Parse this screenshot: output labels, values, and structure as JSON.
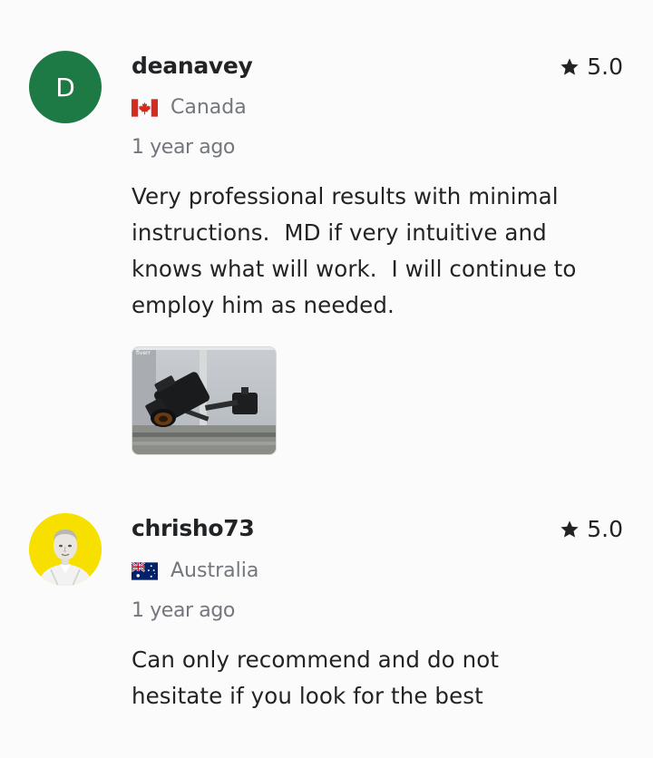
{
  "reviews": [
    {
      "avatar_letter": "D",
      "avatar_color": "#1d7a45",
      "username": "deanavey",
      "rating": "5.0",
      "country": "Canada",
      "flag": "canada-flag-icon",
      "time": "1 year ago",
      "text": "Very professional results with minimal\ninstructions.  MD if very intuitive and\nknows what will work.  I will continue to\nemploy him as needed.",
      "attachment": "camera-on-window-mount-photo"
    },
    {
      "avatar_color": "#f7e000",
      "username": "chrisho73",
      "rating": "5.0",
      "country": "Australia",
      "flag": "australia-flag-icon",
      "time": "1 year ago",
      "text": "Can only recommend and do not\nhesitate if you look for the best"
    }
  ]
}
